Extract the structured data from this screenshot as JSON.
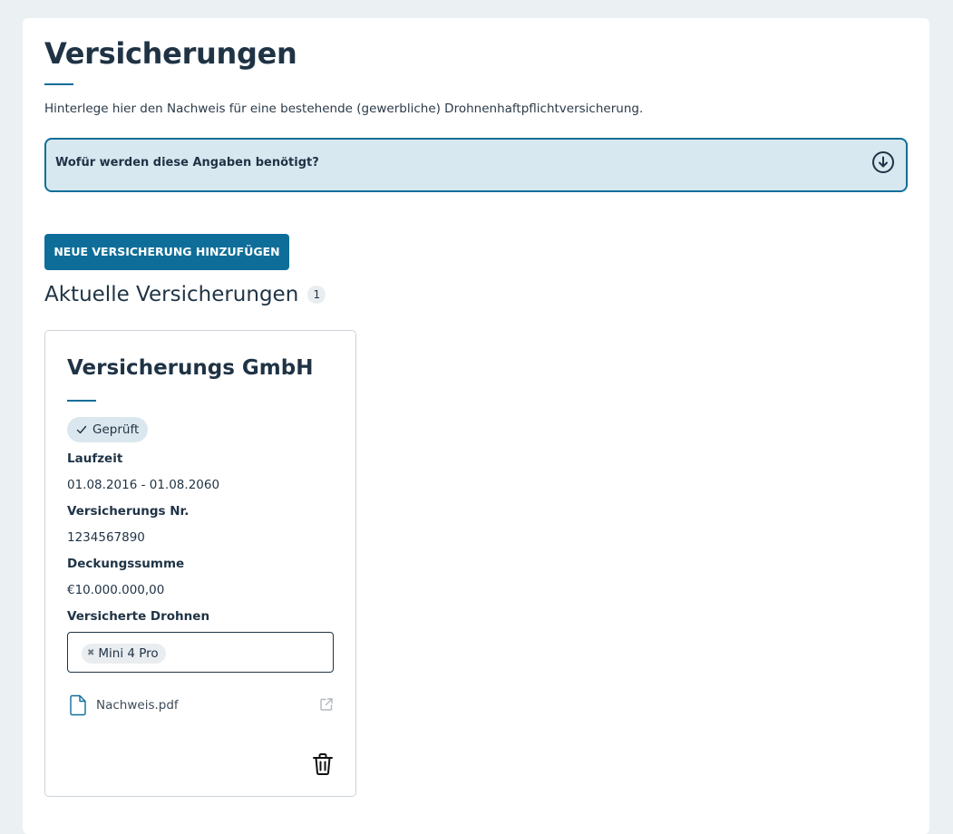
{
  "page": {
    "title": "Versicherungen",
    "subtitle": "Hinterlege hier den Nachweis für eine bestehende (gewerbliche) Drohnenhaftpflichtversicherung."
  },
  "info_box": {
    "label": "Wofür werden diese Angaben benötigt?",
    "icon": "arrow-down-circle-icon"
  },
  "actions": {
    "add_label": "NEUE VERSICHERUNG HINZUFÜGEN"
  },
  "section": {
    "title": "Aktuelle Versicherungen",
    "count": "1"
  },
  "insurance": {
    "company": "Versicherungs GmbH",
    "status": "Geprüft",
    "fields": [
      {
        "label": "Laufzeit",
        "value": "01.08.2016 - 01.08.2060"
      },
      {
        "label": "Versicherungs Nr.",
        "value": "1234567890"
      },
      {
        "label": "Deckungssumme",
        "value": "€10.000.000,00"
      }
    ],
    "drones_label": "Versicherte Drohnen",
    "drones": [
      "Mini 4 Pro"
    ],
    "tag_remove": "✖",
    "file_name": "Nachweis.pdf"
  },
  "colors": {
    "accent": "#0f6e99",
    "background": "#ebf0f3",
    "info_bg": "#d8e8f0",
    "text": "#1f3345"
  }
}
